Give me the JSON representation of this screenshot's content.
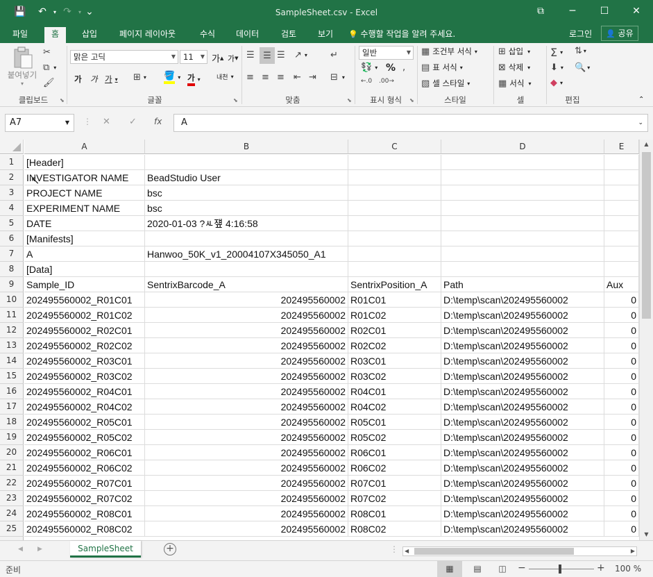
{
  "window": {
    "title": "SampleSheet.csv - Excel",
    "qat": {
      "save_icon": "💾",
      "undo_icon": "↶",
      "redo_icon": "↷",
      "customize_icon": "⌄"
    },
    "controls": {
      "restore_ribbon_icon": "⧉",
      "minimize_icon": "─",
      "maximize_icon": "☐",
      "close_icon": "✕"
    }
  },
  "tabs": [
    {
      "label": "파일"
    },
    {
      "label": "홈"
    },
    {
      "label": "삽입"
    },
    {
      "label": "페이지 레이아웃"
    },
    {
      "label": "수식"
    },
    {
      "label": "데이터"
    },
    {
      "label": "검토"
    },
    {
      "label": "보기"
    }
  ],
  "tellme": {
    "icon": "💡",
    "text": "수행할 작업을 알려 주세요."
  },
  "account": {
    "login": "로그인",
    "share": "공유",
    "share_icon": "👤"
  },
  "ribbon": {
    "clipboard": {
      "paste": "붙여넣기",
      "label": "클립보드"
    },
    "font": {
      "name": "맑은 고딕",
      "size": "11",
      "grow": "가",
      "shrink": "가",
      "bold": "가",
      "italic": "가",
      "underline": "가",
      "fontcolor": "가",
      "phonetic": "내천",
      "label": "글꼴"
    },
    "align": {
      "label": "맞춤"
    },
    "number": {
      "format": "일반",
      "percent": "%",
      "label": "표시 형식"
    },
    "styles": {
      "conditional": "조건부 서식",
      "table": "표 서식",
      "cell": "셀 스타일",
      "label": "스타일"
    },
    "cells": {
      "insert": "삽입",
      "delete": "삭제",
      "format": "서식",
      "label": "셀"
    },
    "editing": {
      "label": "편집"
    }
  },
  "formula": {
    "namebox": "A7",
    "cancel": "✕",
    "enter": "✓",
    "fx": "fx",
    "content": "A"
  },
  "grid": {
    "columns": [
      "A",
      "B",
      "C",
      "D",
      "E"
    ],
    "rows": [
      {
        "n": "1",
        "cells": [
          "[Header]",
          "",
          "",
          "",
          ""
        ]
      },
      {
        "n": "2",
        "cells": [
          "INVESTIGATOR NAME",
          "BeadStudio User",
          "",
          "",
          ""
        ]
      },
      {
        "n": "3",
        "cells": [
          "PROJECT NAME",
          "bsc",
          "",
          "",
          ""
        ]
      },
      {
        "n": "4",
        "cells": [
          "EXPERIMENT NAME",
          "bsc",
          "",
          "",
          ""
        ]
      },
      {
        "n": "5",
        "cells": [
          "DATE",
          "2020-01-03 ?ㅻ쟾 4:16:58",
          "",
          "",
          ""
        ]
      },
      {
        "n": "6",
        "cells": [
          "[Manifests]",
          "",
          "",
          "",
          ""
        ]
      },
      {
        "n": "7",
        "cells": [
          "A",
          "Hanwoo_50K_v1_20004107X345050_A1",
          "",
          "",
          ""
        ]
      },
      {
        "n": "8",
        "cells": [
          "[Data]",
          "",
          "",
          "",
          ""
        ]
      },
      {
        "n": "9",
        "cells": [
          "Sample_ID",
          "SentrixBarcode_A",
          "SentrixPosition_A",
          "Path",
          "Aux"
        ]
      },
      {
        "n": "10",
        "cells": [
          "202495560002_R01C01",
          "202495560002",
          "R01C01",
          "D:\\temp\\scan\\202495560002",
          "0"
        ]
      },
      {
        "n": "11",
        "cells": [
          "202495560002_R01C02",
          "202495560002",
          "R01C02",
          "D:\\temp\\scan\\202495560002",
          "0"
        ]
      },
      {
        "n": "12",
        "cells": [
          "202495560002_R02C01",
          "202495560002",
          "R02C01",
          "D:\\temp\\scan\\202495560002",
          "0"
        ]
      },
      {
        "n": "13",
        "cells": [
          "202495560002_R02C02",
          "202495560002",
          "R02C02",
          "D:\\temp\\scan\\202495560002",
          "0"
        ]
      },
      {
        "n": "14",
        "cells": [
          "202495560002_R03C01",
          "202495560002",
          "R03C01",
          "D:\\temp\\scan\\202495560002",
          "0"
        ]
      },
      {
        "n": "15",
        "cells": [
          "202495560002_R03C02",
          "202495560002",
          "R03C02",
          "D:\\temp\\scan\\202495560002",
          "0"
        ]
      },
      {
        "n": "16",
        "cells": [
          "202495560002_R04C01",
          "202495560002",
          "R04C01",
          "D:\\temp\\scan\\202495560002",
          "0"
        ]
      },
      {
        "n": "17",
        "cells": [
          "202495560002_R04C02",
          "202495560002",
          "R04C02",
          "D:\\temp\\scan\\202495560002",
          "0"
        ]
      },
      {
        "n": "18",
        "cells": [
          "202495560002_R05C01",
          "202495560002",
          "R05C01",
          "D:\\temp\\scan\\202495560002",
          "0"
        ]
      },
      {
        "n": "19",
        "cells": [
          "202495560002_R05C02",
          "202495560002",
          "R05C02",
          "D:\\temp\\scan\\202495560002",
          "0"
        ]
      },
      {
        "n": "20",
        "cells": [
          "202495560002_R06C01",
          "202495560002",
          "R06C01",
          "D:\\temp\\scan\\202495560002",
          "0"
        ]
      },
      {
        "n": "21",
        "cells": [
          "202495560002_R06C02",
          "202495560002",
          "R06C02",
          "D:\\temp\\scan\\202495560002",
          "0"
        ]
      },
      {
        "n": "22",
        "cells": [
          "202495560002_R07C01",
          "202495560002",
          "R07C01",
          "D:\\temp\\scan\\202495560002",
          "0"
        ]
      },
      {
        "n": "23",
        "cells": [
          "202495560002_R07C02",
          "202495560002",
          "R07C02",
          "D:\\temp\\scan\\202495560002",
          "0"
        ]
      },
      {
        "n": "24",
        "cells": [
          "202495560002_R08C01",
          "202495560002",
          "R08C01",
          "D:\\temp\\scan\\202495560002",
          "0"
        ]
      },
      {
        "n": "25",
        "cells": [
          "202495560002_R08C02",
          "202495560002",
          "R08C02",
          "D:\\temp\\scan\\202495560002",
          "0"
        ]
      }
    ]
  },
  "sheets": [
    {
      "name": "SampleSheet"
    }
  ],
  "status": {
    "ready": "준비",
    "zoom": "100 %"
  },
  "colors": {
    "brand": "#217346",
    "ribbon_bg": "#f3f3f3"
  }
}
